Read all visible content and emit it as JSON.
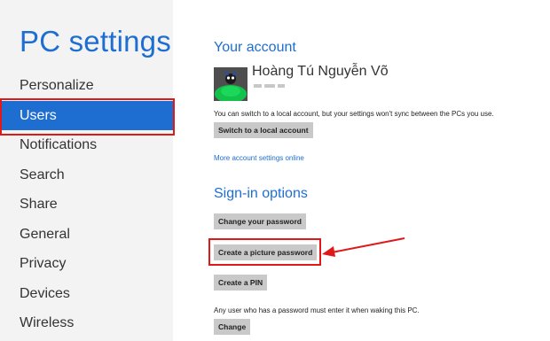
{
  "app": {
    "title": "PC settings"
  },
  "sidebar": {
    "items": [
      {
        "label": "Personalize"
      },
      {
        "label": "Users"
      },
      {
        "label": "Notifications"
      },
      {
        "label": "Search"
      },
      {
        "label": "Share"
      },
      {
        "label": "General"
      },
      {
        "label": "Privacy"
      },
      {
        "label": "Devices"
      },
      {
        "label": "Wireless"
      }
    ],
    "selected": "Users"
  },
  "account": {
    "heading": "Your account",
    "user_name": "Hoàng Tú Nguyễn Võ",
    "local_info": "You can switch to a local account, but your settings won't sync between the PCs you use.",
    "switch_button": "Switch to a local account",
    "more_link": "More account settings online"
  },
  "signin": {
    "heading": "Sign-in options",
    "change_password_button": "Change your password",
    "picture_password_button": "Create a picture password",
    "pin_button": "Create a PIN",
    "wake_info": "Any user who has a password must enter it when waking this PC.",
    "change_button": "Change"
  },
  "colors": {
    "accent": "#1e6ed2",
    "sidebar_bg": "#f3f3f3",
    "button_bg": "#c9c9c9",
    "annotation": "#e01818"
  }
}
